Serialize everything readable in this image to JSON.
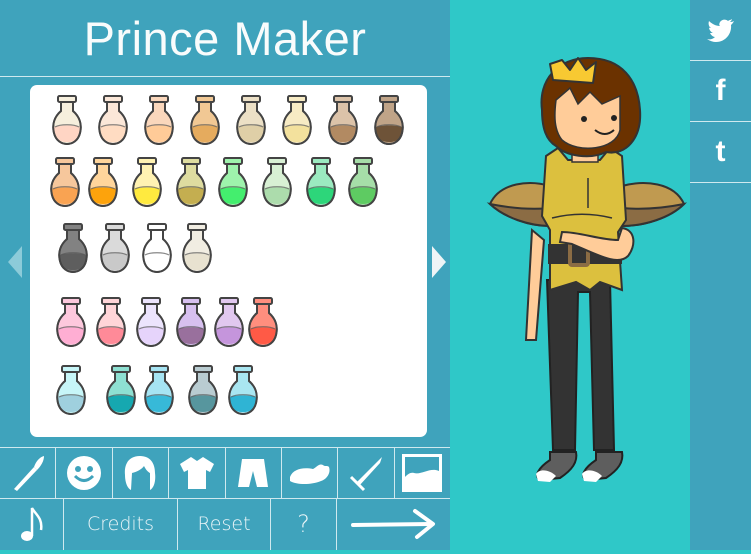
{
  "header": {
    "title": "Prince Maker"
  },
  "palette": {
    "rows": [
      {
        "bottles": [
          {
            "name": "skin-peach-light",
            "fill": "#ffd5c4",
            "glass": "#f6efdd"
          },
          {
            "name": "skin-cream",
            "fill": "#ffdcc2",
            "glass": "#fbe7d8"
          },
          {
            "name": "skin-peach",
            "fill": "#ffcb98",
            "glass": "#fad7bc"
          },
          {
            "name": "skin-tan",
            "fill": "#e5ab5e",
            "glass": "#f1c894"
          },
          {
            "name": "skin-beige",
            "fill": "#dfcfa7",
            "glass": "#ece0c6"
          },
          {
            "name": "skin-butter",
            "fill": "#f3e19d",
            "glass": "#f7ebc4"
          },
          {
            "name": "skin-brown",
            "fill": "#b28a62",
            "glass": "#dcc3a9"
          },
          {
            "name": "skin-dark-brown",
            "fill": "#6e5338",
            "glass": "#c0a488"
          }
        ]
      },
      {
        "bottles": [
          {
            "name": "orange-light",
            "fill": "#f9a352",
            "glass": "#f6c79c"
          },
          {
            "name": "orange",
            "fill": "#fda30c",
            "glass": "#ffd59b"
          },
          {
            "name": "yellow",
            "fill": "#ffea3f",
            "glass": "#fff2b2"
          },
          {
            "name": "olive",
            "fill": "#c4ae50",
            "glass": "#dedca0"
          },
          {
            "name": "green-bright",
            "fill": "#44ee6e",
            "glass": "#9ef3ac"
          },
          {
            "name": "green-pale",
            "fill": "#acdcac",
            "glass": "#d8f0d4"
          },
          {
            "name": "green-emerald",
            "fill": "#2dd67a",
            "glass": "#9beac0"
          },
          {
            "name": "green-leaf",
            "fill": "#5ecb62",
            "glass": "#a6dea8"
          }
        ]
      },
      {
        "bottles": [
          {
            "name": "gray-dark",
            "fill": "#5e5e5e",
            "glass": "#828282"
          },
          {
            "name": "gray-light",
            "fill": "#c9c9c9",
            "glass": "#dadada"
          },
          {
            "name": "white",
            "fill": "#ffffff",
            "glass": "#ffffff"
          },
          {
            "name": "ivory",
            "fill": "#e8e2d0",
            "glass": "#f1ede2"
          }
        ]
      },
      {
        "bottles": [
          {
            "name": "pink",
            "fill": "#ffaed3",
            "glass": "#fdc8dd"
          },
          {
            "name": "pink-salmon",
            "fill": "#ff8a98",
            "glass": "#ffd5d8"
          },
          {
            "name": "lavender",
            "fill": "#e6d4fb",
            "glass": "#ece4fd"
          },
          {
            "name": "purple",
            "fill": "#99709d",
            "glass": "#d7c0ef"
          },
          {
            "name": "violet",
            "fill": "#c595dc",
            "glass": "#e1c8ef"
          },
          {
            "name": "red",
            "fill": "#ff5a46",
            "glass": "#ff8e7e"
          }
        ]
      },
      {
        "bottles": [
          {
            "name": "blue-pale",
            "fill": "#9fd0de",
            "glass": "#c7f6f8"
          },
          {
            "name": "teal",
            "fill": "#16a8b0",
            "glass": "#8ee0d2"
          },
          {
            "name": "sky-blue",
            "fill": "#37b9d8",
            "glass": "#a6e4f3"
          },
          {
            "name": "slate-teal",
            "fill": "#57969e",
            "glass": "#b9ccd1"
          },
          {
            "name": "cyan",
            "fill": "#2fb4d4",
            "glass": "#a9e6f1"
          }
        ]
      }
    ]
  },
  "nav": {
    "prev": "previous-page",
    "next": "next-page"
  },
  "categories": [
    {
      "id": "paint",
      "icon": "paintbrush-icon"
    },
    {
      "id": "face",
      "icon": "smiley-face-icon"
    },
    {
      "id": "hair",
      "icon": "hair-icon"
    },
    {
      "id": "shirt",
      "icon": "shirt-icon"
    },
    {
      "id": "pants",
      "icon": "shorts-icon"
    },
    {
      "id": "shoes",
      "icon": "shoe-icon"
    },
    {
      "id": "weapon",
      "icon": "sword-icon"
    },
    {
      "id": "background",
      "icon": "background-icon"
    }
  ],
  "bottom": {
    "music_icon": "music-note-icon",
    "credits": "Credits",
    "reset": "Reset",
    "help": "?",
    "next_icon": "arrow-right-icon"
  },
  "social": [
    {
      "name": "twitter",
      "icon": "twitter-icon"
    },
    {
      "name": "facebook",
      "label": "f"
    },
    {
      "name": "tumblr",
      "label": "t"
    }
  ],
  "colors": {
    "panel": "#3fa3bc",
    "stage": "#2fc8c8",
    "divider": "#cfe9ef"
  },
  "character": {
    "skin": "#ffcc99",
    "hair": "#6b3200",
    "crown": "#f8c932",
    "shirt": "#dcc03e",
    "pauldrons": "#c09a50",
    "pants": "#333333",
    "shoes": "#5e5e5e"
  }
}
